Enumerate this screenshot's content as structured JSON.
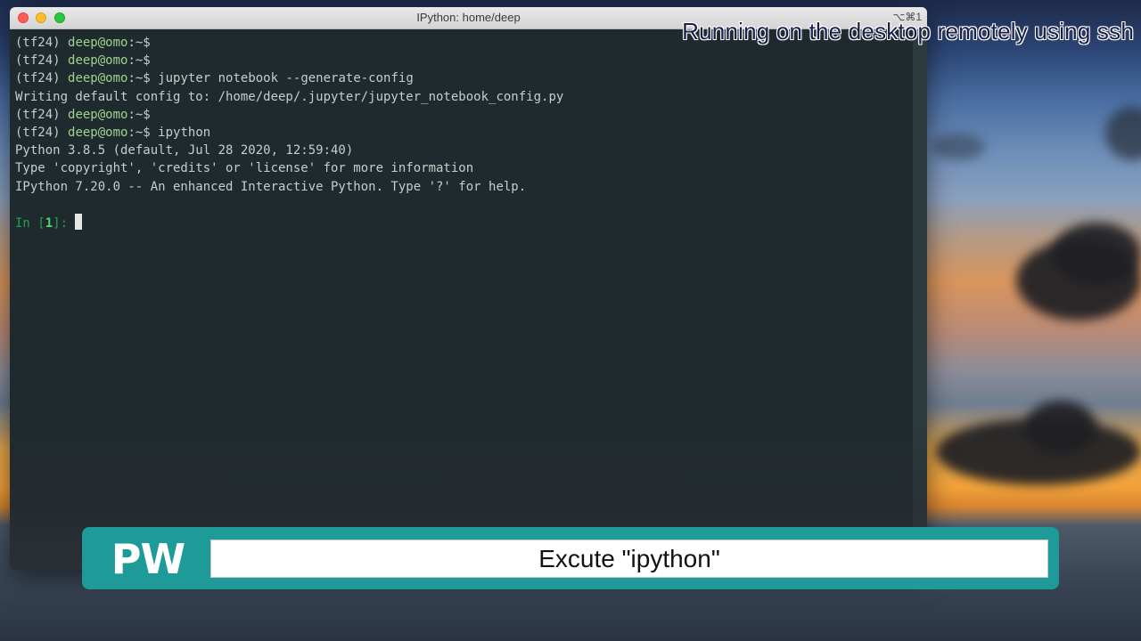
{
  "window": {
    "title": "IPython: home/deep",
    "shortcut": "⌥⌘1"
  },
  "terminal": {
    "lines": [
      {
        "type": "prompt",
        "env": "(tf24) ",
        "user": "deep@omo",
        "path": ":~$",
        "cmd": ""
      },
      {
        "type": "prompt",
        "env": "(tf24) ",
        "user": "deep@omo",
        "path": ":~$",
        "cmd": ""
      },
      {
        "type": "prompt",
        "env": "(tf24) ",
        "user": "deep@omo",
        "path": ":~$",
        "cmd": " jupyter notebook --generate-config"
      },
      {
        "type": "text",
        "text": "Writing default config to: /home/deep/.jupyter/jupyter_notebook_config.py"
      },
      {
        "type": "prompt",
        "env": "(tf24) ",
        "user": "deep@omo",
        "path": ":~$",
        "cmd": ""
      },
      {
        "type": "prompt",
        "env": "(tf24) ",
        "user": "deep@omo",
        "path": ":~$",
        "cmd": " ipython"
      },
      {
        "type": "text",
        "text": "Python 3.8.5 (default, Jul 28 2020, 12:59:40)"
      },
      {
        "type": "text",
        "text": "Type 'copyright', 'credits' or 'license' for more information"
      },
      {
        "type": "text",
        "text": "IPython 7.20.0 -- An enhanced Interactive Python. Type '?' for help."
      }
    ],
    "input_prompt": {
      "prefix": "In [",
      "number": "1",
      "suffix": "]: "
    }
  },
  "overlay_text": "Running on the desktop remotely using ssh",
  "banner": {
    "logo": "PW",
    "caption": "Excute \"ipython\""
  },
  "colors": {
    "terminal_bg": "#1f2a2e",
    "prompt_user": "#9ed38d",
    "ipython_prompt": "#26a04a",
    "banner_teal": "#1e9a98"
  }
}
